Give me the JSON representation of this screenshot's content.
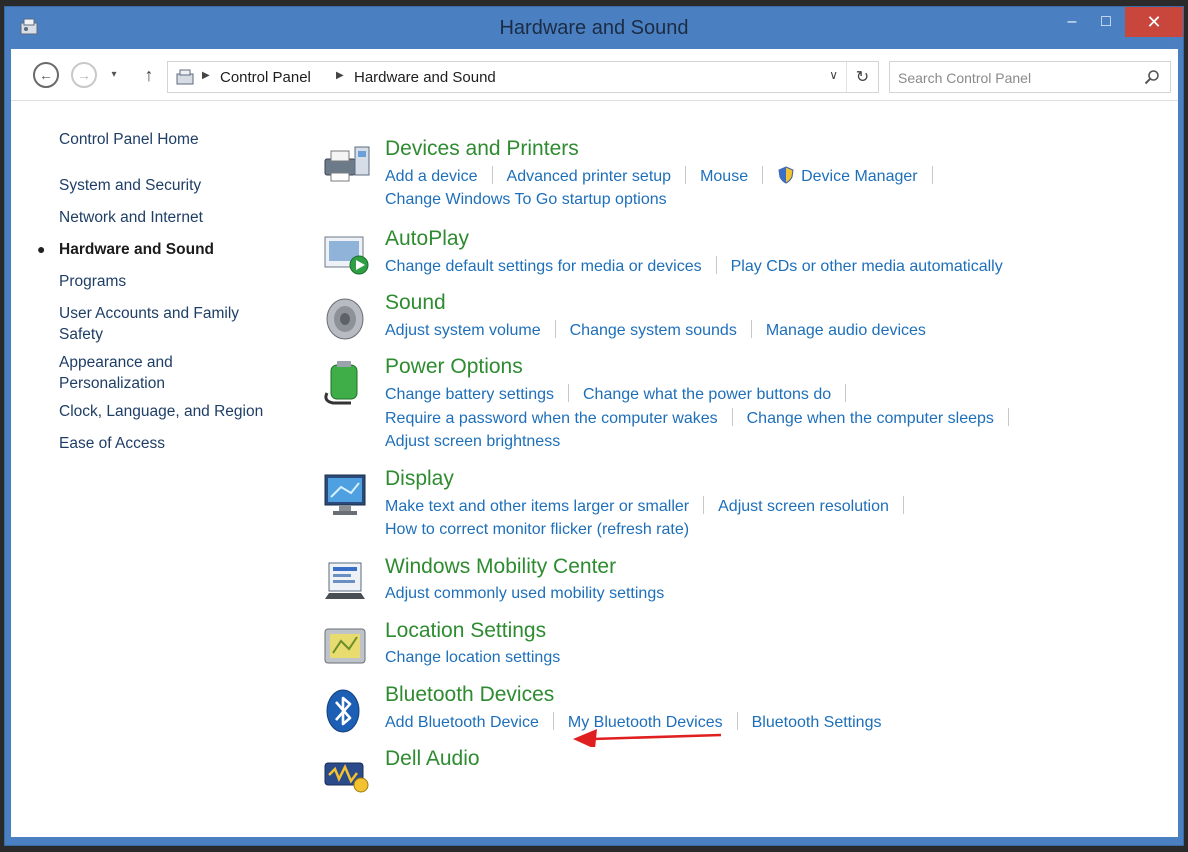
{
  "window": {
    "title": "Hardware and Sound",
    "minimize": "–",
    "maximize": "□",
    "close": "✕"
  },
  "nav": {
    "back": "←",
    "forward": "→",
    "recent": "▾",
    "up": "↑",
    "breadcrumbs": [
      "Control Panel",
      "Hardware and Sound"
    ],
    "refresh": "↻",
    "dropdown": "∨",
    "search_placeholder": "Search Control Panel"
  },
  "sidebar": {
    "home": "Control Panel Home",
    "items": [
      {
        "label": "System and Security",
        "active": false
      },
      {
        "label": "Network and Internet",
        "active": false
      },
      {
        "label": "Hardware and Sound",
        "active": true
      },
      {
        "label": "Programs",
        "active": false
      },
      {
        "label": "User Accounts and Family\nSafety",
        "active": false
      },
      {
        "label": "Appearance and\nPersonalization",
        "active": false
      },
      {
        "label": "Clock, Language, and Region",
        "active": false
      },
      {
        "label": "Ease of Access",
        "active": false
      }
    ]
  },
  "categories": [
    {
      "title": "Devices and Printers",
      "icon": "printer-icon",
      "lines": [
        [
          "Add a device",
          "Advanced printer setup",
          "Mouse",
          "Device Manager"
        ],
        [
          "Change Windows To Go startup options"
        ]
      ]
    },
    {
      "title": "AutoPlay",
      "icon": "autoplay-icon",
      "lines": [
        [
          "Change default settings for media or devices",
          "Play CDs or other media automatically"
        ]
      ]
    },
    {
      "title": "Sound",
      "icon": "speaker-icon",
      "lines": [
        [
          "Adjust system volume",
          "Change system sounds",
          "Manage audio devices"
        ]
      ]
    },
    {
      "title": "Power Options",
      "icon": "battery-icon",
      "lines": [
        [
          "Change battery settings",
          "Change what the power buttons do"
        ],
        [
          "Require a password when the computer wakes",
          "Change when the computer sleeps"
        ],
        [
          "Adjust screen brightness"
        ]
      ]
    },
    {
      "title": "Display",
      "icon": "monitor-icon",
      "lines": [
        [
          "Make text and other items larger or smaller",
          "Adjust screen resolution"
        ],
        [
          "How to correct monitor flicker (refresh rate)"
        ]
      ]
    },
    {
      "title": "Windows Mobility Center",
      "icon": "mobility-icon",
      "lines": [
        [
          "Adjust commonly used mobility settings"
        ]
      ]
    },
    {
      "title": "Location Settings",
      "icon": "location-icon",
      "lines": [
        [
          "Change location settings"
        ]
      ]
    },
    {
      "title": "Bluetooth Devices",
      "icon": "bluetooth-icon",
      "lines": [
        [
          "Add Bluetooth Device",
          "My Bluetooth Devices",
          "Bluetooth Settings"
        ]
      ]
    },
    {
      "title": "Dell Audio",
      "icon": "dell-audio-icon",
      "lines": []
    }
  ],
  "colors": {
    "category_title": "#2e8b30",
    "link": "#1e6fba",
    "titlebar": "#4a7fc1",
    "close": "#c9463d",
    "annotation_arrow": "#e02020"
  }
}
